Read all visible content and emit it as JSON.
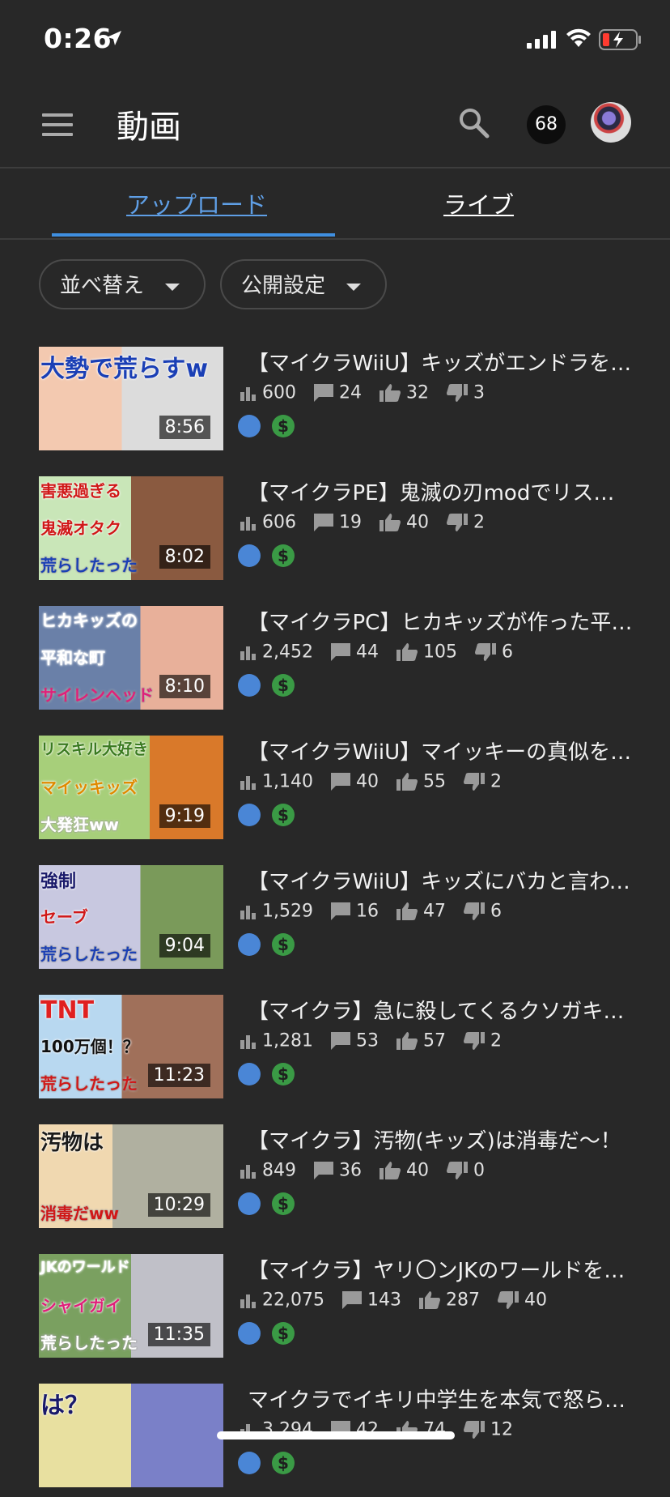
{
  "status_bar": {
    "time": "0:26"
  },
  "header": {
    "title": "動画",
    "notification_count": "68"
  },
  "tabs": {
    "uploads": "アップロード",
    "live": "ライブ"
  },
  "filters": {
    "sort": "並べ替え",
    "visibility": "公開設定"
  },
  "colors": {
    "background": "#282828",
    "accent": "#3f8fe0",
    "public": "#4a86d6",
    "monetized": "#3a9a45"
  },
  "videos": [
    {
      "title": "【マイクラWiiU】キッズがエンドラを倒さないので大勢で荒らしてみた",
      "duration": "8:56",
      "views": "600",
      "comments": "24",
      "likes": "32",
      "dislikes": "3",
      "thumb": {
        "line1": "大勢で荒らすw",
        "line2": "",
        "line3": ""
      }
    },
    {
      "title": "【マイクラPE】鬼滅の刃modでリスキルしてみた",
      "duration": "8:02",
      "views": "606",
      "comments": "19",
      "likes": "40",
      "dislikes": "2",
      "thumb": {
        "line1": "害悪過ぎる",
        "line2": "鬼滅オタク",
        "line3": "荒らしたった"
      }
    },
    {
      "title": "【マイクラPC】ヒカキッズが作った平和な町を荒らしてみた",
      "duration": "8:10",
      "views": "2,452",
      "comments": "44",
      "likes": "105",
      "dislikes": "6",
      "thumb": {
        "line1": "ヒカキッズの",
        "line2": "平和な町",
        "line3": "サイレンヘッド"
      }
    },
    {
      "title": "【マイクラWiiU】マイッキーの真似をするキッズを荒らしてみた",
      "duration": "9:19",
      "views": "1,140",
      "comments": "40",
      "likes": "55",
      "dislikes": "2",
      "thumb": {
        "line1": "リスキル大好き",
        "line2": "マイッキッズ",
        "line3": "大発狂ww"
      }
    },
    {
      "title": "【マイクラWiiU】キッズにバカと言われたので荒らしてみた",
      "duration": "9:04",
      "views": "1,529",
      "comments": "16",
      "likes": "47",
      "dislikes": "6",
      "thumb": {
        "line1": "強制",
        "line2": "セーブ",
        "line3": "荒らしたった"
      }
    },
    {
      "title": "【マイクラ】急に殺してくるクソガキを荒らしてみた",
      "duration": "11:23",
      "views": "1,281",
      "comments": "53",
      "likes": "57",
      "dislikes": "2",
      "thumb": {
        "line1": "TNT",
        "line2": "100万個！？",
        "line3": "荒らしたった"
      }
    },
    {
      "title": "【マイクラ】汚物(キッズ)は消毒だ〜！",
      "duration": "10:29",
      "views": "849",
      "comments": "36",
      "likes": "40",
      "dislikes": "0",
      "thumb": {
        "line1": "汚物は",
        "line2": "",
        "line3": "消毒だww"
      }
    },
    {
      "title": "【マイクラ】ヤリ〇ンJKのワールドを荒らしてみた",
      "duration": "11:35",
      "views": "22,075",
      "comments": "143",
      "likes": "287",
      "dislikes": "40",
      "thumb": {
        "line1": "JKのワールド",
        "line2": "シャイガイ",
        "line3": "荒らしたった"
      }
    },
    {
      "title": "マイクラでイキリ中学生を本気で怒らせてみた",
      "duration": "",
      "views": "3,294",
      "comments": "42",
      "likes": "74",
      "dislikes": "12",
      "thumb": {
        "line1": "は？",
        "line2": "",
        "line3": ""
      }
    }
  ]
}
